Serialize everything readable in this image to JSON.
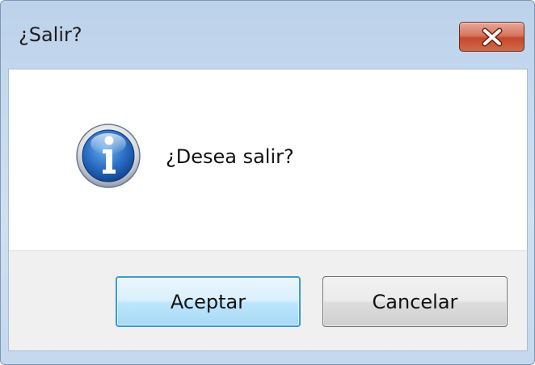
{
  "window": {
    "title": "¿Salir?",
    "close_icon": "close-icon"
  },
  "message": {
    "icon": "info-icon",
    "text": "¿Desea salir?"
  },
  "buttons": {
    "ok_label": "Aceptar",
    "cancel_label": "Cancelar"
  },
  "colors": {
    "title_bar": "#c6daef",
    "close_button": "#c44a2c",
    "info_icon": "#1f5fb0",
    "default_button_border": "#3c9bd6",
    "button_bar": "#f0f0f0"
  }
}
